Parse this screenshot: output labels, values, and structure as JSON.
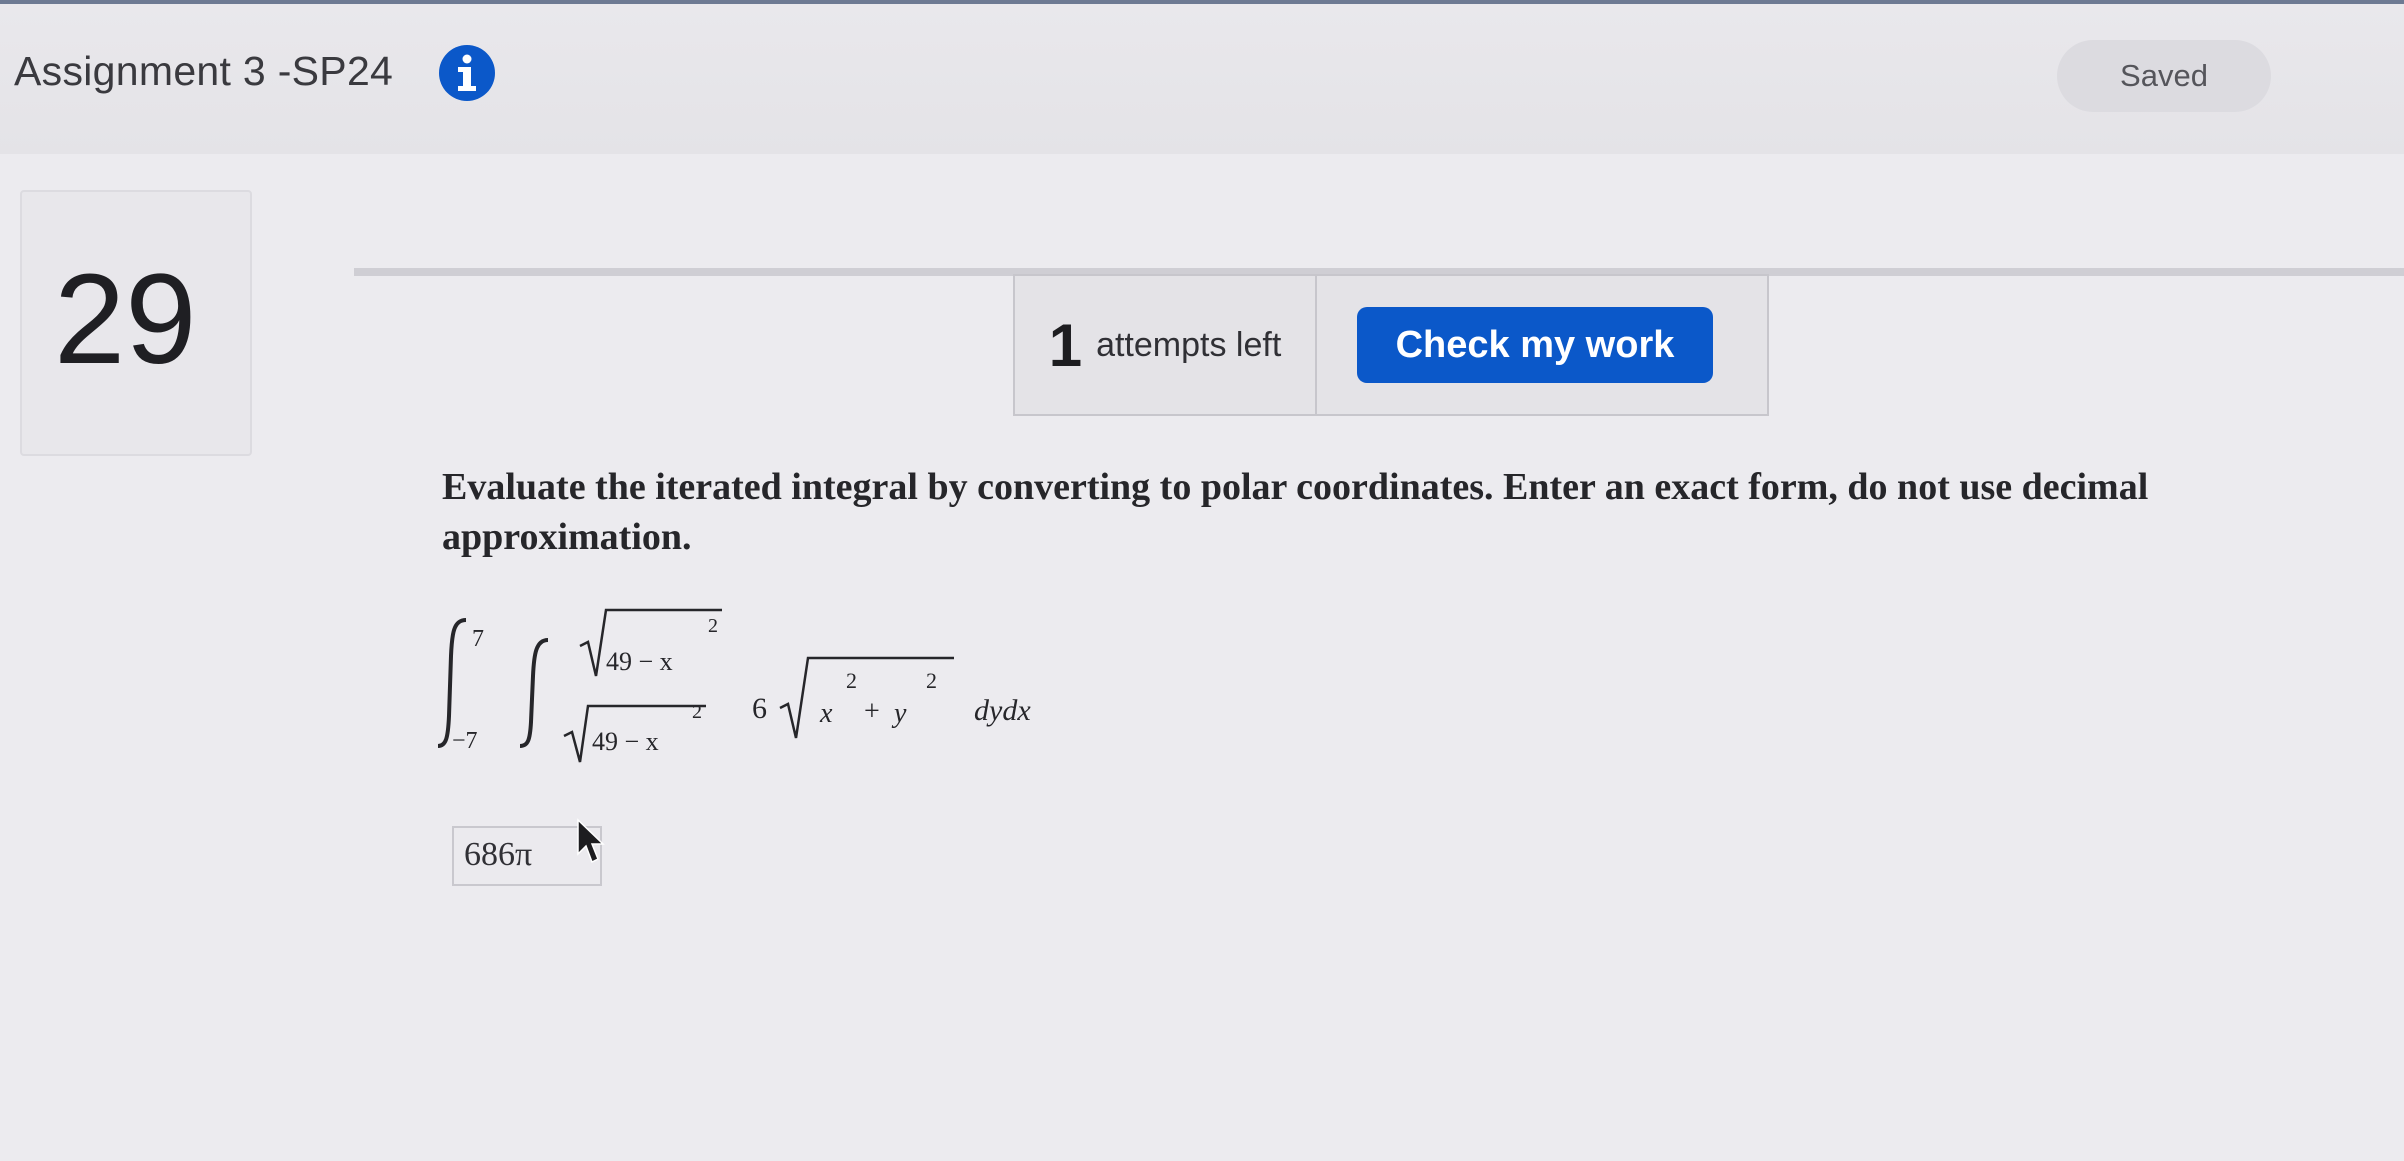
{
  "header": {
    "title": "Assignment 3 -SP24",
    "info_icon": "info-icon",
    "saved_label": "Saved"
  },
  "question": {
    "number": "29",
    "attempts_count": "1",
    "attempts_label": "attempts left",
    "check_button_label": "Check my work",
    "prompt": "Evaluate the iterated integral by converting to polar coordinates. Enter an exact form, do not use decimal approximation.",
    "integral": {
      "outer_upper": "7",
      "outer_lower": "−7",
      "inner_upper_radicand": "49 − x",
      "inner_upper_exp": "2",
      "inner_lower_radicand": "49 − x",
      "inner_lower_exp": "2",
      "coefficient": "6",
      "integrand_x": "x",
      "integrand_x_exp": "2",
      "integrand_plus": "+",
      "integrand_y": "y",
      "integrand_y_exp": "2",
      "differential": "dydx"
    },
    "answer_value": "686π"
  },
  "colors": {
    "accent_button": "#0b58c9",
    "info_icon": "#0b58c9",
    "background": "#ecebef"
  }
}
